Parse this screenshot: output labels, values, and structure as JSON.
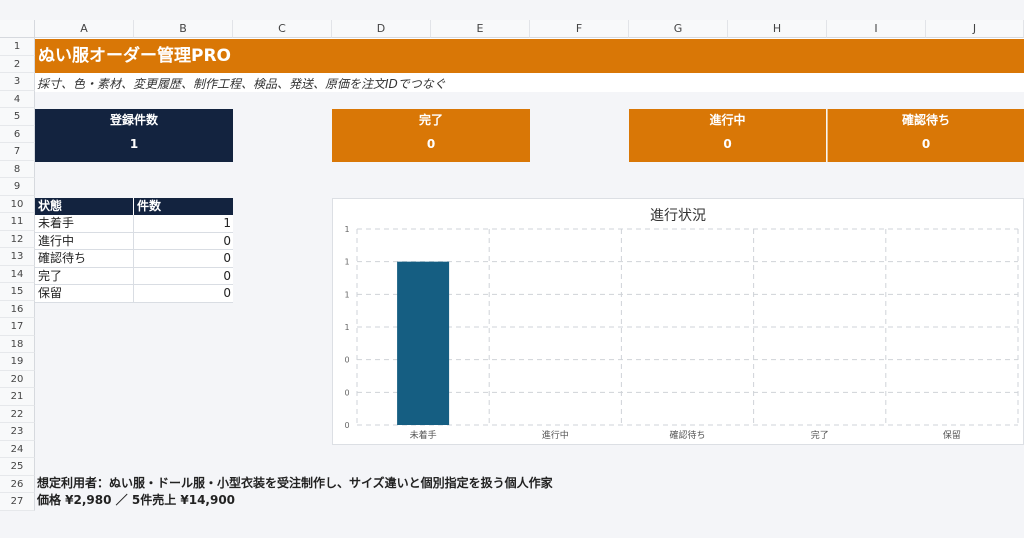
{
  "columns": [
    "A",
    "B",
    "C",
    "D",
    "E",
    "F",
    "G",
    "H",
    "I",
    "J"
  ],
  "rows": [
    "1",
    "2",
    "3",
    "4",
    "5",
    "6",
    "7",
    "8",
    "9",
    "10",
    "11",
    "12",
    "13",
    "14",
    "15",
    "16",
    "17",
    "18",
    "19",
    "20",
    "21",
    "22",
    "23",
    "24",
    "25",
    "26",
    "27"
  ],
  "title": "ぬい服オーダー管理PRO",
  "subtitle": "採寸、色・素材、変更履歴、制作工程、検品、発送、原価を注文IDでつなぐ",
  "kpis": [
    {
      "label": "登録件数",
      "value": "1"
    },
    {
      "label": "完了",
      "value": "0"
    },
    {
      "label": "進行中",
      "value": "0"
    },
    {
      "label": "確認待ち",
      "value": "0"
    }
  ],
  "status_table": {
    "headers": [
      "状態",
      "件数"
    ],
    "rows": [
      {
        "status": "未着手",
        "count": "1"
      },
      {
        "status": "進行中",
        "count": "0"
      },
      {
        "status": "確認待ち",
        "count": "0"
      },
      {
        "status": "完了",
        "count": "0"
      },
      {
        "status": "保留",
        "count": "0"
      }
    ]
  },
  "chart_data": {
    "type": "bar",
    "title": "進行状況",
    "categories": [
      "未着手",
      "進行中",
      "確認待ち",
      "完了",
      "保留"
    ],
    "values": [
      1,
      0,
      0,
      0,
      0
    ],
    "ytick_labels": [
      "1",
      "1",
      "1",
      "1",
      "0",
      "0",
      "0"
    ],
    "ylim": [
      0,
      1.2
    ],
    "grid": true,
    "bar_color": "#155e82"
  },
  "footer": {
    "line1": "想定利用者：ぬい服・ドール服・小型衣装を受注制作し、サイズ違いと個別指定を扱う個人作家",
    "line2": "価格 ¥2,980 ／ 5件売上 ¥14,900"
  },
  "colors": {
    "accent": "#d97706",
    "navy": "#13233f",
    "bar": "#155e82"
  }
}
